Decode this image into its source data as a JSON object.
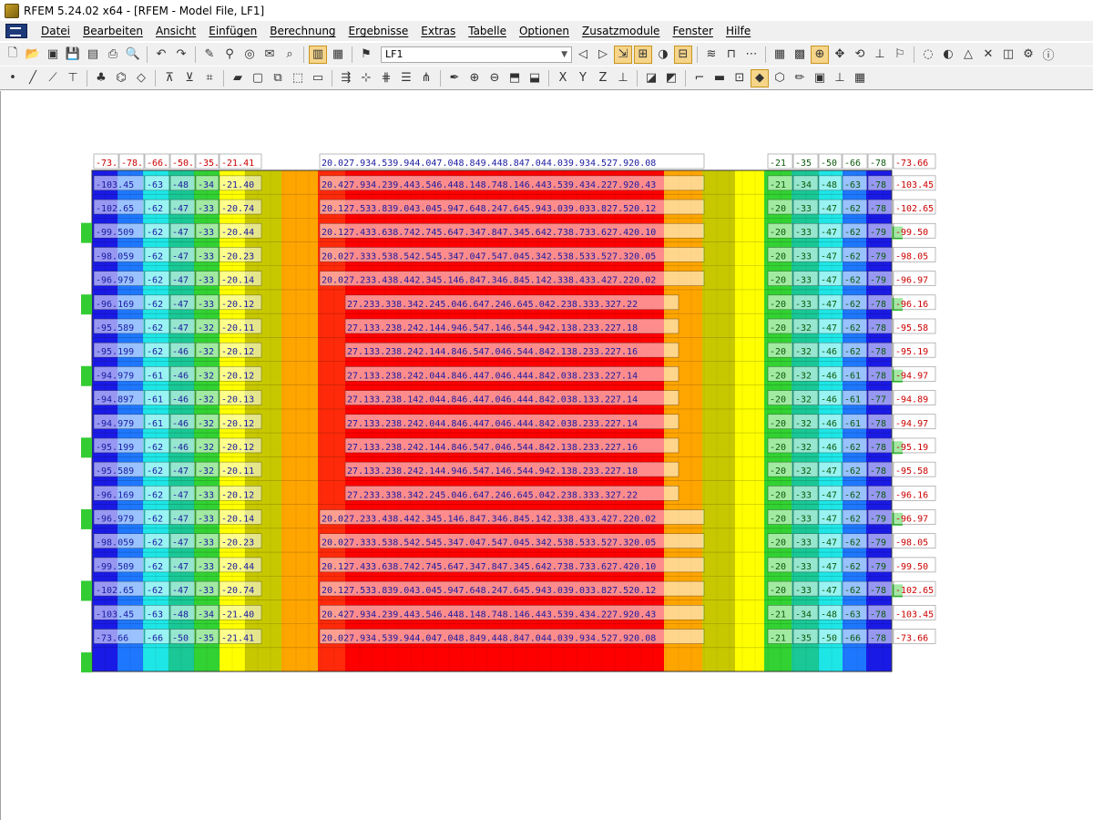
{
  "window": {
    "title": "RFEM 5.24.02 x64 - [RFEM - Model File, LF1]"
  },
  "menu": [
    "Datei",
    "Bearbeiten",
    "Ansicht",
    "Einfügen",
    "Berechnung",
    "Ergebnisse",
    "Extras",
    "Tabelle",
    "Optionen",
    "Zusatzmodule",
    "Fenster",
    "Hilfe"
  ],
  "toolbar": {
    "load_case": "LF1"
  },
  "colors": {
    "blue_dark": "#1a1ae6",
    "blue": "#1e78ff",
    "cyan": "#1ee6e6",
    "teal": "#19c896",
    "green": "#32d232",
    "yellowgreen": "#b4dc1e",
    "yellow": "#ffff00",
    "olive": "#c8c800",
    "orange": "#ffa500",
    "orangered": "#ff6414",
    "red": "#ff0000",
    "label_red": "#cc0000",
    "label_blue": "#1a1aa0"
  },
  "left_rows": [
    [
      "-73.",
      "-78.",
      "-66.",
      "-50.",
      "-35.",
      "-21.41"
    ],
    [
      "-103.45",
      "-63",
      "-48",
      "-34",
      "-21.40"
    ],
    [
      "-102.65",
      "-62",
      "-47",
      "-33",
      "-20.74"
    ],
    [
      "-99.509",
      "-62",
      "-47",
      "-33",
      "-20.44"
    ],
    [
      "-98.059",
      "-62",
      "-47",
      "-33",
      "-20.23"
    ],
    [
      "-96.979",
      "-62",
      "-47",
      "-33",
      "-20.14"
    ],
    [
      "-96.169",
      "-62",
      "-47",
      "-33",
      "-20.12"
    ],
    [
      "-95.589",
      "-62",
      "-47",
      "-32",
      "-20.11"
    ],
    [
      "-95.199",
      "-62",
      "-46",
      "-32",
      "-20.12"
    ],
    [
      "-94.979",
      "-61",
      "-46",
      "-32",
      "-20.12"
    ],
    [
      "-94.897",
      "-61",
      "-46",
      "-32",
      "-20.13"
    ],
    [
      "-94.979",
      "-61",
      "-46",
      "-32",
      "-20.12"
    ],
    [
      "-95.199",
      "-62",
      "-46",
      "-32",
      "-20.12"
    ],
    [
      "-95.589",
      "-62",
      "-47",
      "-32",
      "-20.11"
    ],
    [
      "-96.169",
      "-62",
      "-47",
      "-33",
      "-20.12"
    ],
    [
      "-96.979",
      "-62",
      "-47",
      "-33",
      "-20.14"
    ],
    [
      "-98.059",
      "-62",
      "-47",
      "-33",
      "-20.23"
    ],
    [
      "-99.509",
      "-62",
      "-47",
      "-33",
      "-20.44"
    ],
    [
      "-102.65",
      "-62",
      "-47",
      "-33",
      "-20.74"
    ],
    [
      "-103.45",
      "-63",
      "-48",
      "-34",
      "-21.40"
    ],
    [
      "-73.66",
      "-66",
      "-50",
      "-35",
      "-21.41"
    ]
  ],
  "center_rows": [
    "20.027.934.539.944.047.048.849.448.847.044.039.934.527.920.08",
    "20.427.934.239.443.546.448.148.748.146.443.539.434.227.920.43",
    "20.127.533.839.043.045.947.648.247.645.943.039.033.827.520.12",
    "20.127.433.638.742.745.647.347.847.345.642.738.733.627.420.10",
    "20.027.333.538.542.545.347.047.547.045.342.538.533.527.320.05",
    "20.027.233.438.442.345.146.847.346.845.142.338.433.427.220.02",
    "27.233.338.342.245.046.647.246.645.042.238.333.327.22",
    "27.133.238.242.144.946.547.146.544.942.138.233.227.18",
    "27.133.238.242.144.846.547.046.544.842.138.233.227.16",
    "27.133.238.242.044.846.447.046.444.842.038.233.227.14",
    "27.133.238.142.044.846.447.046.444.842.038.133.227.14",
    "27.133.238.242.044.846.447.046.444.842.038.233.227.14",
    "27.133.238.242.144.846.547.046.544.842.138.233.227.16",
    "27.133.238.242.144.946.547.146.544.942.138.233.227.18",
    "27.233.338.342.245.046.647.246.645.042.238.333.327.22",
    "20.027.233.438.442.345.146.847.346.845.142.338.433.427.220.02",
    "20.027.333.538.542.545.347.047.547.045.342.538.533.527.320.05",
    "20.127.433.638.742.745.647.347.847.345.642.738.733.627.420.10",
    "20.127.533.839.043.045.947.648.247.645.943.039.033.827.520.12",
    "20.427.934.239.443.546.448.148.748.146.443.539.434.227.920.43",
    "20.027.934.539.944.047.048.849.448.847.044.039.934.527.920.08"
  ],
  "right_rows": [
    [
      "-21",
      "-35",
      "-50",
      "-66",
      "-78",
      "-73.66"
    ],
    [
      "-21",
      "-34",
      "-48",
      "-63",
      "-78",
      "-103.45"
    ],
    [
      "-20",
      "-33",
      "-47",
      "-62",
      "-78",
      "-102.65"
    ],
    [
      "-20",
      "-33",
      "-47",
      "-62",
      "-79",
      "-99.50"
    ],
    [
      "-20",
      "-33",
      "-47",
      "-62",
      "-79",
      "-98.05"
    ],
    [
      "-20",
      "-33",
      "-47",
      "-62",
      "-79",
      "-96.97"
    ],
    [
      "-20",
      "-33",
      "-47",
      "-62",
      "-78",
      "-96.16"
    ],
    [
      "-20",
      "-32",
      "-47",
      "-62",
      "-78",
      "-95.58"
    ],
    [
      "-20",
      "-32",
      "-46",
      "-62",
      "-78",
      "-95.19"
    ],
    [
      "-20",
      "-32",
      "-46",
      "-61",
      "-78",
      "-94.97"
    ],
    [
      "-20",
      "-32",
      "-46",
      "-61",
      "-77",
      "-94.89"
    ],
    [
      "-20",
      "-32",
      "-46",
      "-61",
      "-78",
      "-94.97"
    ],
    [
      "-20",
      "-32",
      "-46",
      "-62",
      "-78",
      "-95.19"
    ],
    [
      "-20",
      "-32",
      "-47",
      "-62",
      "-78",
      "-95.58"
    ],
    [
      "-20",
      "-33",
      "-47",
      "-62",
      "-78",
      "-96.16"
    ],
    [
      "-20",
      "-33",
      "-47",
      "-62",
      "-79",
      "-96.97"
    ],
    [
      "-20",
      "-33",
      "-47",
      "-62",
      "-79",
      "-98.05"
    ],
    [
      "-20",
      "-33",
      "-47",
      "-62",
      "-79",
      "-99.50"
    ],
    [
      "-20",
      "-33",
      "-47",
      "-62",
      "-78",
      "-102.65"
    ],
    [
      "-21",
      "-34",
      "-48",
      "-63",
      "-78",
      "-103.45"
    ],
    [
      "-21",
      "-35",
      "-50",
      "-66",
      "-78",
      "-73.66"
    ]
  ]
}
